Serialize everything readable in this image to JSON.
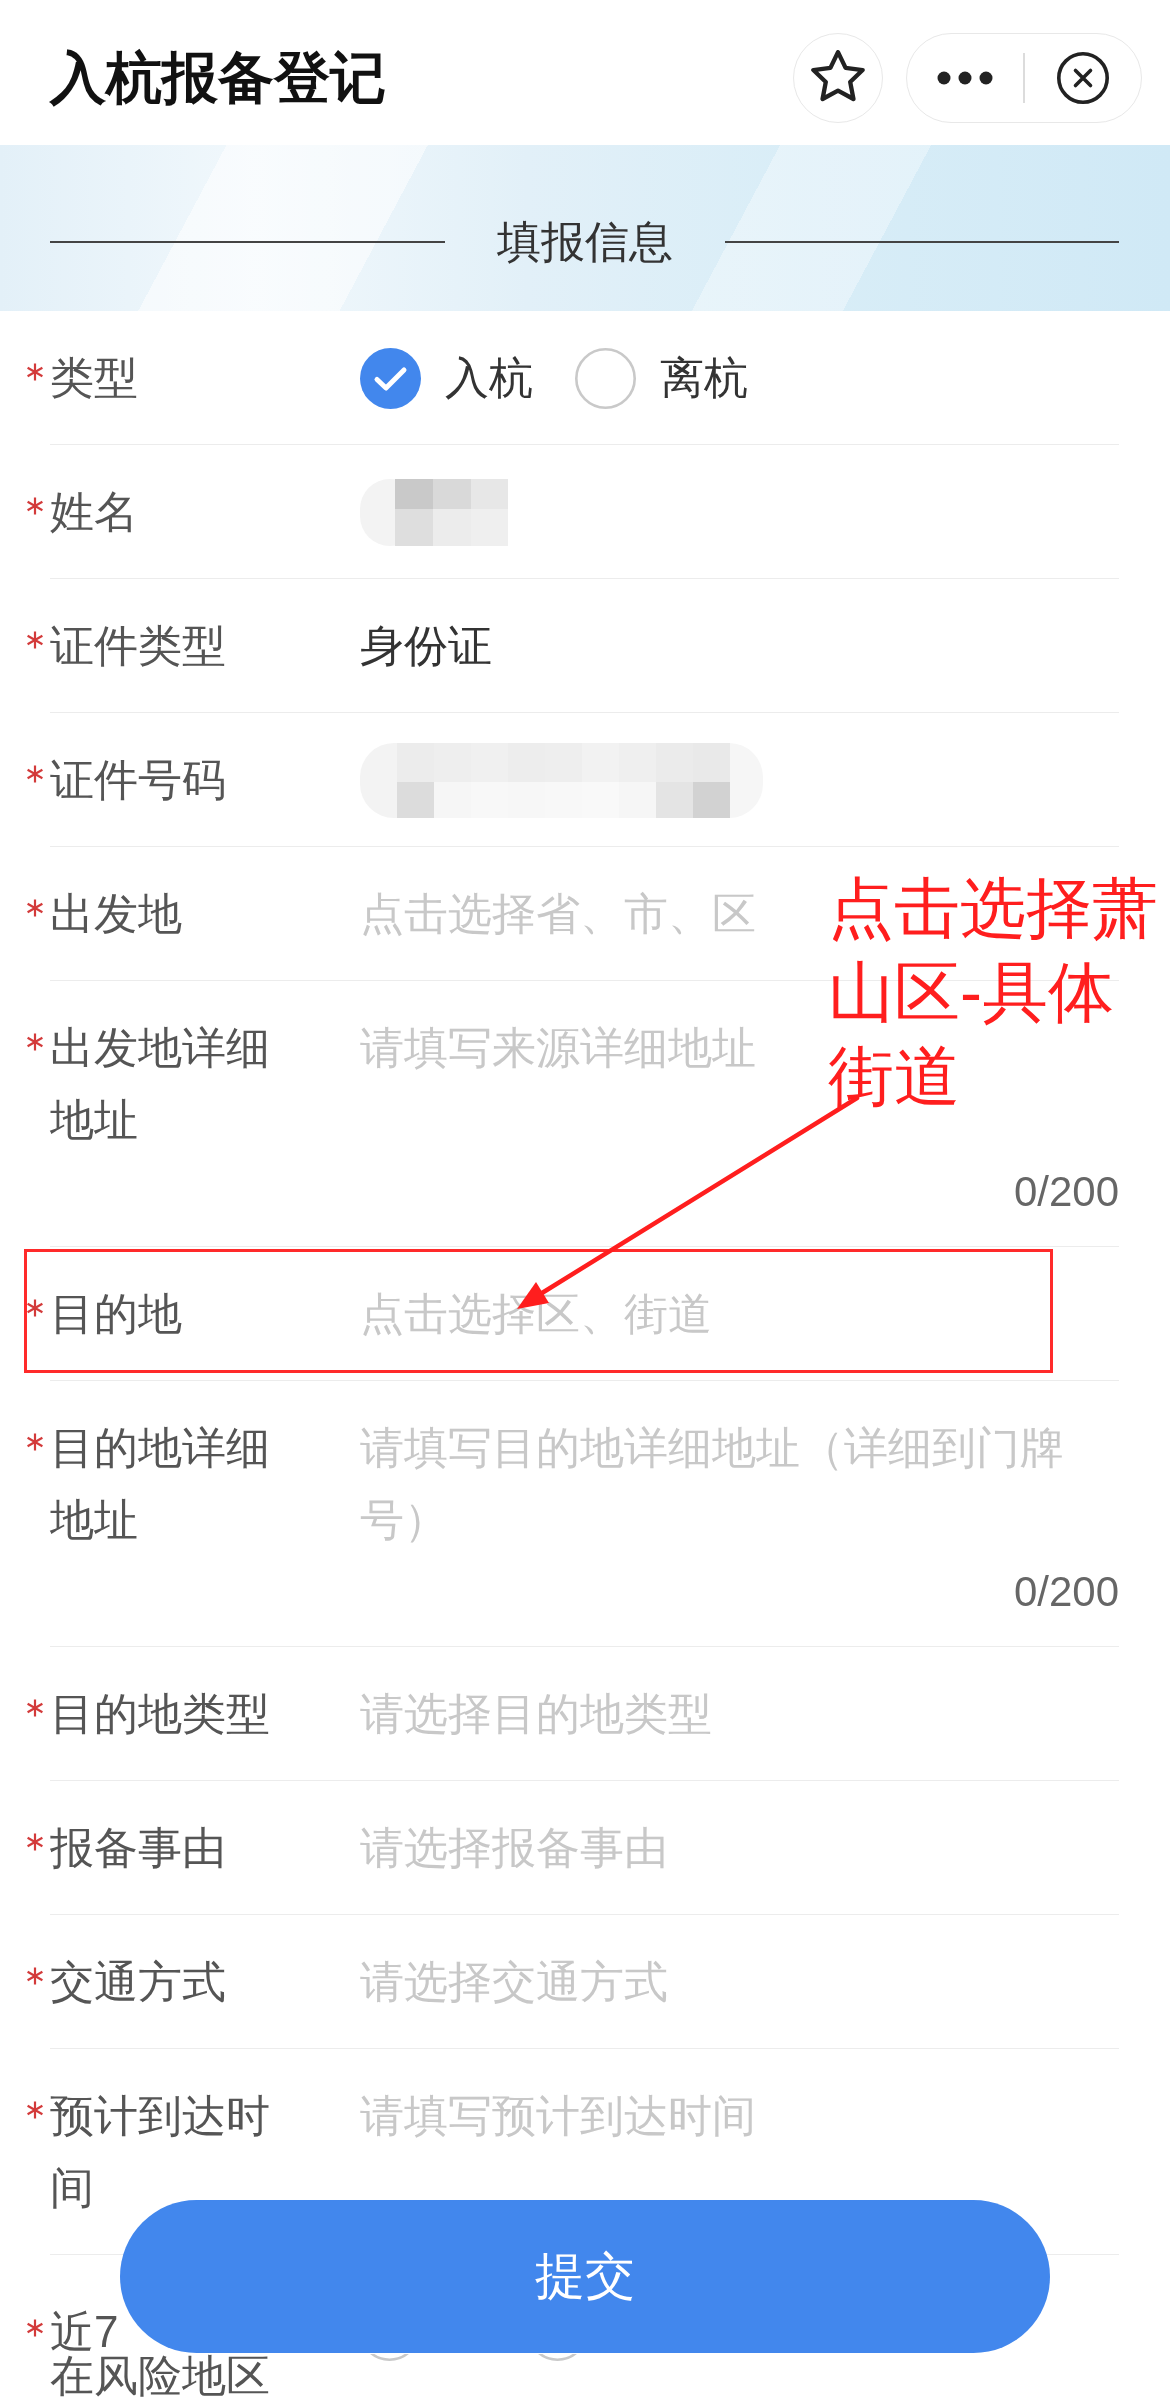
{
  "header": {
    "title": "入杭报备登记"
  },
  "banner": {
    "title": "填报信息"
  },
  "form": {
    "rows": [
      {
        "kind": "radio",
        "label": "类型",
        "required": true,
        "highlighted": false,
        "options": [
          {
            "label": "入杭",
            "selected": true
          },
          {
            "label": "离杭",
            "selected": false
          }
        ]
      },
      {
        "kind": "pixelated",
        "label": "姓名",
        "required": true,
        "highlighted": false
      },
      {
        "kind": "picker",
        "label": "证件类型",
        "required": true,
        "highlighted": false,
        "value": "身份证"
      },
      {
        "kind": "pixelated",
        "label": "证件号码",
        "required": true,
        "highlighted": false
      },
      {
        "kind": "picker",
        "label": "出发地",
        "required": true,
        "highlighted": false,
        "placeholder": "点击选择省、市、区"
      },
      {
        "kind": "textarea",
        "label": "出发地详细地址",
        "required": true,
        "highlighted": false,
        "placeholder": "请填写来源详细地址",
        "counter": "0/200"
      },
      {
        "kind": "picker",
        "label": "目的地",
        "required": true,
        "highlighted": true,
        "placeholder": "点击选择区、街道"
      },
      {
        "kind": "textarea",
        "label": "目的地详细地址",
        "required": true,
        "highlighted": false,
        "placeholder": "请填写目的地详细地址（详细到门牌号）",
        "counter": "0/200"
      },
      {
        "kind": "picker",
        "label": "目的地类型",
        "required": true,
        "highlighted": false,
        "placeholder": "请选择目的地类型"
      },
      {
        "kind": "picker",
        "label": "报备事由",
        "required": true,
        "highlighted": false,
        "placeholder": "请选择报备事由"
      },
      {
        "kind": "picker",
        "label": "交通方式",
        "required": true,
        "highlighted": false,
        "placeholder": "请选择交通方式"
      },
      {
        "kind": "input",
        "label": "预计到达时间",
        "required": true,
        "highlighted": false,
        "placeholder": "请填写预计到达时间"
      },
      {
        "kind": "radio",
        "label_lines": [
          "近7",
          "在风险地区"
        ],
        "required": true,
        "highlighted": false,
        "options": [
          {
            "selected": false
          },
          {
            "selected": false
          }
        ]
      }
    ]
  },
  "submit_button": {
    "label": "提交"
  },
  "annotation": {
    "text": "点击选择萧山区-具体街道"
  }
}
